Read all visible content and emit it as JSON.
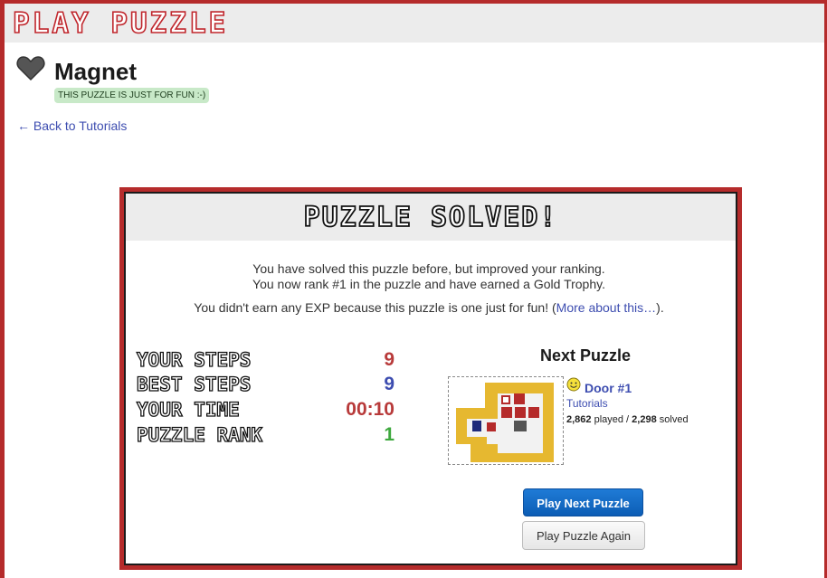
{
  "site": {
    "logo_text": "PLAY PUZZLE"
  },
  "puzzle": {
    "title": "Magnet",
    "badge": "THIS PUZZLE IS JUST FOR FUN :-)"
  },
  "nav": {
    "back_link": "← Back to Tutorials"
  },
  "modal": {
    "title": "PUZZLE SOLVED!",
    "message_line1": "You have solved this puzzle before, but improved your ranking.",
    "message_line2": "You now rank #1 in the puzzle and have earned a Gold Trophy.",
    "message_exp": "You didn't earn any EXP because this puzzle is one just for fun! (",
    "message_exp_link": "More about this…",
    "message_exp_end": ").",
    "stats": [
      {
        "label": "YOUR STEPS",
        "value": "9",
        "color": "#b83a3a"
      },
      {
        "label": "BEST STEPS",
        "value": "9",
        "color": "#3d4db0"
      },
      {
        "label": "YOUR TIME",
        "value": "00:10",
        "color": "#b83a3a"
      },
      {
        "label": "PUZZLE RANK",
        "value": "1",
        "color": "#3da83d"
      }
    ],
    "next_puzzle": {
      "heading": "Next Puzzle",
      "name": "Door #1",
      "category": "Tutorials",
      "played": "2,862",
      "played_suffix": " played / ",
      "solved": "2,298",
      "solved_suffix": " solved",
      "icons": [
        "smiley-icon"
      ]
    },
    "buttons": {
      "play_next": "Play Next Puzzle",
      "play_again": "Play Puzzle Again"
    }
  },
  "colors": {
    "accent_red": "#b52b2b",
    "link_blue": "#3d4db0",
    "button_blue": "#0c5db5",
    "badge_green": "#c8e9c8"
  }
}
